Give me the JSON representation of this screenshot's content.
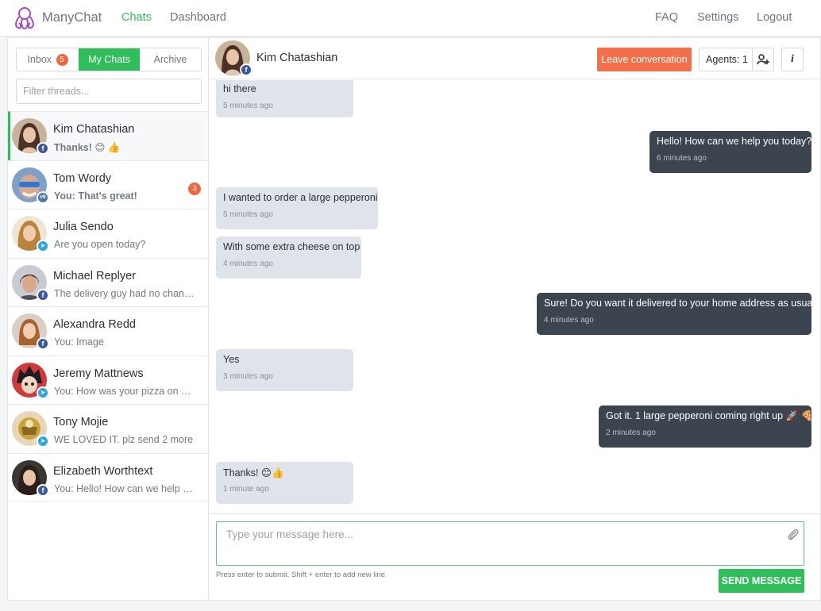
{
  "app": {
    "brand": "ManyChat",
    "nav": {
      "chats": "Chats",
      "dashboard": "Dashboard",
      "faq": "FAQ",
      "settings": "Settings",
      "logout": "Logout"
    }
  },
  "sidebar": {
    "tabs": {
      "inbox": "Inbox",
      "inbox_count": "5",
      "my_chats": "My Chats",
      "archive": "Archive"
    },
    "filter_placeholder": "Filter threads...",
    "threads": [
      {
        "name": "Kim Chatashian",
        "preview": "Thanks! 😊 👍",
        "network": "facebook",
        "unread": ""
      },
      {
        "name": "Tom Wordy",
        "preview": "You: That's great!",
        "network": "vk",
        "unread": "3"
      },
      {
        "name": "Julia Sendo",
        "preview": "Are you open today?",
        "network": "telegram",
        "unread": ""
      },
      {
        "name": "Michael Replyer",
        "preview": "The delivery guy had no change.",
        "network": "facebook",
        "unread": ""
      },
      {
        "name": "Alexandra Redd",
        "preview": "You: Image",
        "network": "facebook",
        "unread": ""
      },
      {
        "name": "Jeremy Mattnews",
        "preview": "You: How was your pizza on a s...",
        "network": "telegram",
        "unread": ""
      },
      {
        "name": "Tony Mojie",
        "preview": "WE LOVED IT. plz send 2 more",
        "network": "telegram",
        "unread": ""
      },
      {
        "name": "Elizabeth Worthtext",
        "preview": "You: Hello! How can we help yo...",
        "network": "facebook",
        "unread": ""
      }
    ]
  },
  "chat": {
    "contact_name": "Kim Chatashian",
    "leave_label": "Leave conversation",
    "agents_label": "Agents: 1",
    "info_label": "i",
    "messages": [
      {
        "direction": "in",
        "text": "hi there",
        "time": "5 minutes ago"
      },
      {
        "direction": "out",
        "text": "Hello! How can we help you today?",
        "time": "6 minutes ago"
      },
      {
        "direction": "in",
        "text": "I wanted to order a large pepperoni",
        "time": "5 minutes ago"
      },
      {
        "direction": "in",
        "text": "With some extra cheese on top",
        "time": "4 minutes ago"
      },
      {
        "direction": "out",
        "text": "Sure! Do you want it delivered to your home address as usual?",
        "time": "4 minutes ago"
      },
      {
        "direction": "in",
        "text": "Yes",
        "time": "3 minutes ago"
      },
      {
        "direction": "out",
        "text": "Got it. 1 large pepperoni coming right up 🚀 🍕",
        "time": "2 minutes ago"
      },
      {
        "direction": "in",
        "text": "Thanks! 😊👍",
        "time": "1 minute ago"
      }
    ],
    "composer": {
      "placeholder": "Type your message here...",
      "hint": "Press enter to submit. Shift + enter to add new line",
      "send_label": "SEND MESSAGE"
    }
  },
  "colors": {
    "accent": "#2fbf5a",
    "danger": "#f36f4a",
    "badge": "#f0673f",
    "outgoing": "#3c4450",
    "incoming": "#dfe3ea"
  }
}
